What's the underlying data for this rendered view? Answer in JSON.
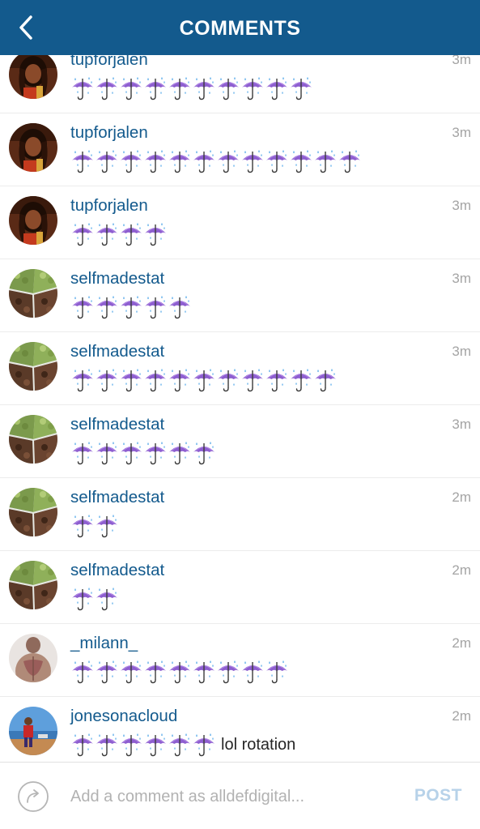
{
  "header": {
    "title": "COMMENTS",
    "back_icon": "chevron-left-icon"
  },
  "colors": {
    "header_bg": "#135a8d",
    "username": "#135a8d",
    "timestamp": "#a4a4a4",
    "post_disabled": "#b7d2e9",
    "placeholder": "#b2b2b2"
  },
  "comments": [
    {
      "username": "tupforjalen",
      "time": "3m",
      "avatar": "reggae-artist",
      "umbrellas": 10,
      "text": ""
    },
    {
      "username": "tupforjalen",
      "time": "3m",
      "avatar": "reggae-artist",
      "umbrellas": 12,
      "text": ""
    },
    {
      "username": "tupforjalen",
      "time": "3m",
      "avatar": "reggae-artist",
      "umbrellas": 4,
      "text": ""
    },
    {
      "username": "selfmadestat",
      "time": "3m",
      "avatar": "food-tray",
      "umbrellas": 5,
      "text": ""
    },
    {
      "username": "selfmadestat",
      "time": "3m",
      "avatar": "food-tray",
      "umbrellas": 11,
      "text": ""
    },
    {
      "username": "selfmadestat",
      "time": "3m",
      "avatar": "food-tray",
      "umbrellas": 6,
      "text": ""
    },
    {
      "username": "selfmadestat",
      "time": "2m",
      "avatar": "food-tray",
      "umbrellas": 2,
      "text": ""
    },
    {
      "username": "selfmadestat",
      "time": "2m",
      "avatar": "food-tray",
      "umbrellas": 2,
      "text": ""
    },
    {
      "username": "_milann_",
      "time": "2m",
      "avatar": "person-back",
      "umbrellas": 9,
      "text": ""
    },
    {
      "username": "jonesonacloud",
      "time": "2m",
      "avatar": "person-beach",
      "umbrellas": 6,
      "text": "lol rotation"
    }
  ],
  "emoji_icon": "umbrella-with-rain-icon",
  "footer": {
    "share_icon": "share-arrow-icon",
    "placeholder": "Add a comment as alldefdigital...",
    "value": "",
    "post_label": "POST"
  }
}
